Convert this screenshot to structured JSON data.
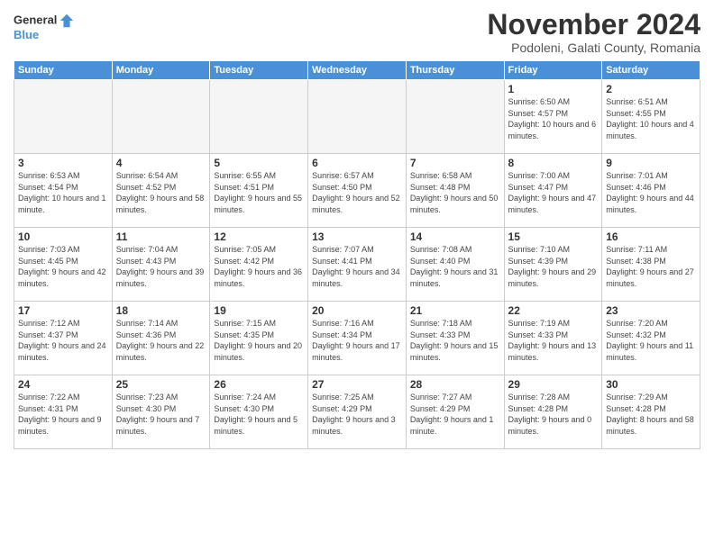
{
  "logo": {
    "line1": "General",
    "line2": "Blue"
  },
  "title": "November 2024",
  "subtitle": "Podoleni, Galati County, Romania",
  "weekdays": [
    "Sunday",
    "Monday",
    "Tuesday",
    "Wednesday",
    "Thursday",
    "Friday",
    "Saturday"
  ],
  "weeks": [
    [
      {
        "day": "",
        "info": ""
      },
      {
        "day": "",
        "info": ""
      },
      {
        "day": "",
        "info": ""
      },
      {
        "day": "",
        "info": ""
      },
      {
        "day": "",
        "info": ""
      },
      {
        "day": "1",
        "info": "Sunrise: 6:50 AM\nSunset: 4:57 PM\nDaylight: 10 hours and 6 minutes."
      },
      {
        "day": "2",
        "info": "Sunrise: 6:51 AM\nSunset: 4:55 PM\nDaylight: 10 hours and 4 minutes."
      }
    ],
    [
      {
        "day": "3",
        "info": "Sunrise: 6:53 AM\nSunset: 4:54 PM\nDaylight: 10 hours and 1 minute."
      },
      {
        "day": "4",
        "info": "Sunrise: 6:54 AM\nSunset: 4:52 PM\nDaylight: 9 hours and 58 minutes."
      },
      {
        "day": "5",
        "info": "Sunrise: 6:55 AM\nSunset: 4:51 PM\nDaylight: 9 hours and 55 minutes."
      },
      {
        "day": "6",
        "info": "Sunrise: 6:57 AM\nSunset: 4:50 PM\nDaylight: 9 hours and 52 minutes."
      },
      {
        "day": "7",
        "info": "Sunrise: 6:58 AM\nSunset: 4:48 PM\nDaylight: 9 hours and 50 minutes."
      },
      {
        "day": "8",
        "info": "Sunrise: 7:00 AM\nSunset: 4:47 PM\nDaylight: 9 hours and 47 minutes."
      },
      {
        "day": "9",
        "info": "Sunrise: 7:01 AM\nSunset: 4:46 PM\nDaylight: 9 hours and 44 minutes."
      }
    ],
    [
      {
        "day": "10",
        "info": "Sunrise: 7:03 AM\nSunset: 4:45 PM\nDaylight: 9 hours and 42 minutes."
      },
      {
        "day": "11",
        "info": "Sunrise: 7:04 AM\nSunset: 4:43 PM\nDaylight: 9 hours and 39 minutes."
      },
      {
        "day": "12",
        "info": "Sunrise: 7:05 AM\nSunset: 4:42 PM\nDaylight: 9 hours and 36 minutes."
      },
      {
        "day": "13",
        "info": "Sunrise: 7:07 AM\nSunset: 4:41 PM\nDaylight: 9 hours and 34 minutes."
      },
      {
        "day": "14",
        "info": "Sunrise: 7:08 AM\nSunset: 4:40 PM\nDaylight: 9 hours and 31 minutes."
      },
      {
        "day": "15",
        "info": "Sunrise: 7:10 AM\nSunset: 4:39 PM\nDaylight: 9 hours and 29 minutes."
      },
      {
        "day": "16",
        "info": "Sunrise: 7:11 AM\nSunset: 4:38 PM\nDaylight: 9 hours and 27 minutes."
      }
    ],
    [
      {
        "day": "17",
        "info": "Sunrise: 7:12 AM\nSunset: 4:37 PM\nDaylight: 9 hours and 24 minutes."
      },
      {
        "day": "18",
        "info": "Sunrise: 7:14 AM\nSunset: 4:36 PM\nDaylight: 9 hours and 22 minutes."
      },
      {
        "day": "19",
        "info": "Sunrise: 7:15 AM\nSunset: 4:35 PM\nDaylight: 9 hours and 20 minutes."
      },
      {
        "day": "20",
        "info": "Sunrise: 7:16 AM\nSunset: 4:34 PM\nDaylight: 9 hours and 17 minutes."
      },
      {
        "day": "21",
        "info": "Sunrise: 7:18 AM\nSunset: 4:33 PM\nDaylight: 9 hours and 15 minutes."
      },
      {
        "day": "22",
        "info": "Sunrise: 7:19 AM\nSunset: 4:33 PM\nDaylight: 9 hours and 13 minutes."
      },
      {
        "day": "23",
        "info": "Sunrise: 7:20 AM\nSunset: 4:32 PM\nDaylight: 9 hours and 11 minutes."
      }
    ],
    [
      {
        "day": "24",
        "info": "Sunrise: 7:22 AM\nSunset: 4:31 PM\nDaylight: 9 hours and 9 minutes."
      },
      {
        "day": "25",
        "info": "Sunrise: 7:23 AM\nSunset: 4:30 PM\nDaylight: 9 hours and 7 minutes."
      },
      {
        "day": "26",
        "info": "Sunrise: 7:24 AM\nSunset: 4:30 PM\nDaylight: 9 hours and 5 minutes."
      },
      {
        "day": "27",
        "info": "Sunrise: 7:25 AM\nSunset: 4:29 PM\nDaylight: 9 hours and 3 minutes."
      },
      {
        "day": "28",
        "info": "Sunrise: 7:27 AM\nSunset: 4:29 PM\nDaylight: 9 hours and 1 minute."
      },
      {
        "day": "29",
        "info": "Sunrise: 7:28 AM\nSunset: 4:28 PM\nDaylight: 9 hours and 0 minutes."
      },
      {
        "day": "30",
        "info": "Sunrise: 7:29 AM\nSunset: 4:28 PM\nDaylight: 8 hours and 58 minutes."
      }
    ]
  ]
}
